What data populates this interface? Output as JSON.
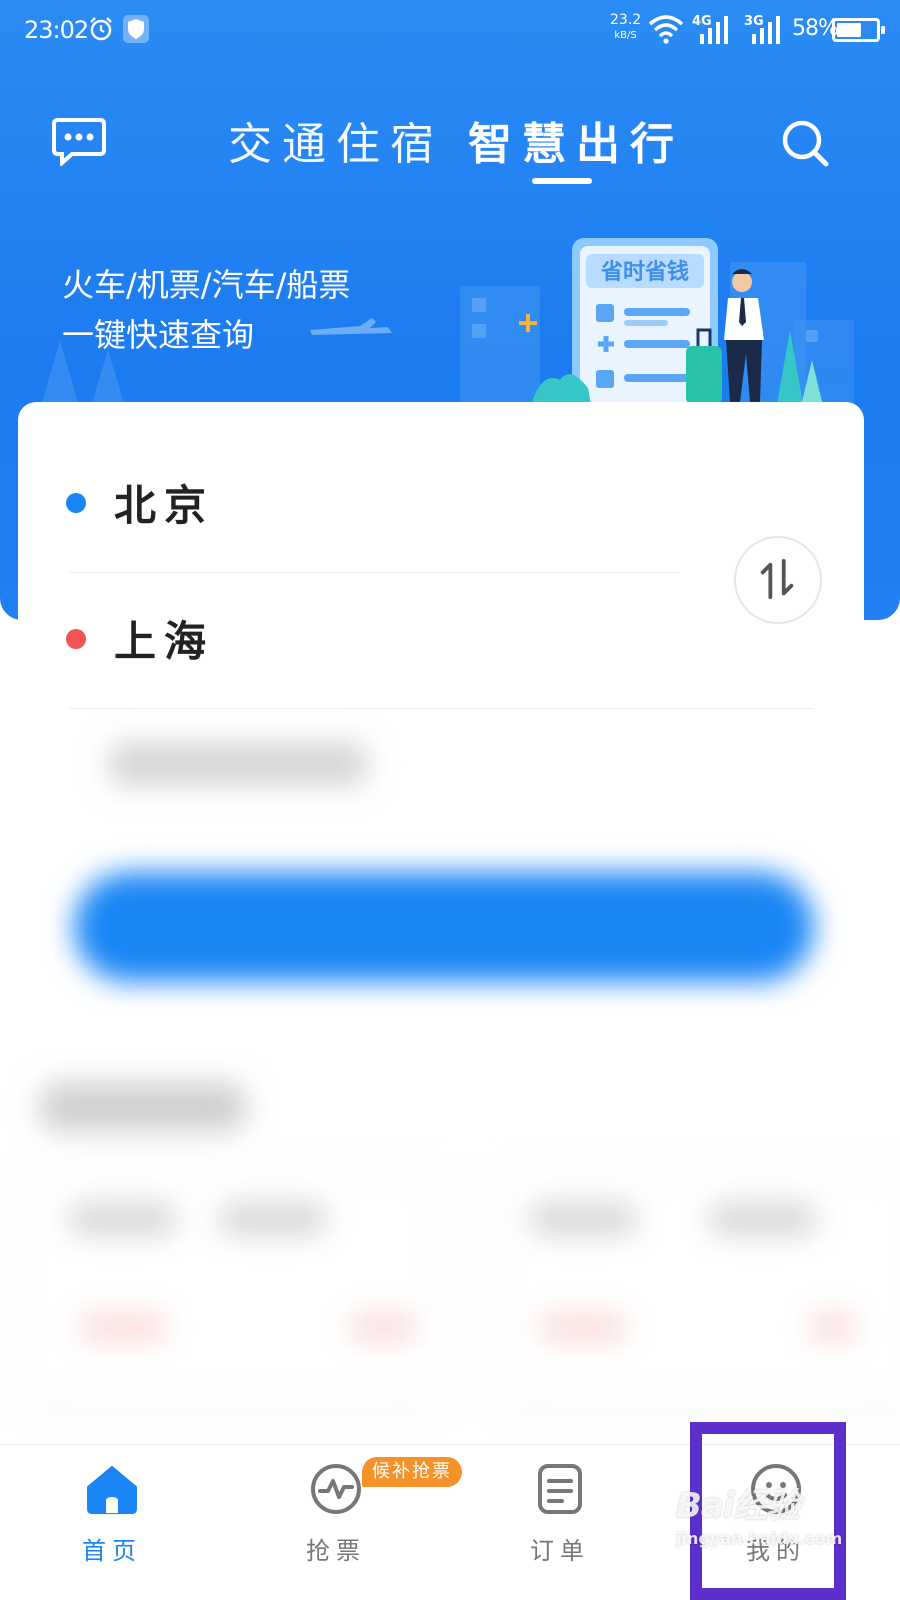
{
  "status_bar": {
    "time": "23:02",
    "net_speed": "23.2",
    "net_speed_unit": "kB/S",
    "signal1_label": "4G",
    "signal2_label": "3G",
    "battery": "58%",
    "battery_level": 0.58
  },
  "header": {
    "tabs": [
      {
        "label": "交通住宿",
        "active": false
      },
      {
        "label": "智慧出行",
        "active": true
      }
    ]
  },
  "banner": {
    "line1": "火车/机票/汽车/船票",
    "line2": "一键快速查询",
    "illustration_tag": "省时省钱"
  },
  "route": {
    "from": "北京",
    "to": "上海",
    "from_dot_color": "#1a86f5",
    "to_dot_color": "#f25353"
  },
  "bottom_nav": {
    "items": [
      {
        "label": "首页",
        "icon": "home-icon",
        "active": true
      },
      {
        "label": "抢票",
        "icon": "pulse-icon",
        "active": false
      },
      {
        "label": "订单",
        "icon": "order-icon",
        "active": false
      },
      {
        "label": "我的",
        "icon": "user-icon",
        "active": false
      }
    ],
    "badge": "候补抢票"
  },
  "watermark": {
    "main": "Bai经验",
    "sub": "jingyan.baidu.com"
  },
  "colors": {
    "primary": "#1a86f5",
    "highlight": "#5b2fc9",
    "badge": "#f5932a"
  }
}
